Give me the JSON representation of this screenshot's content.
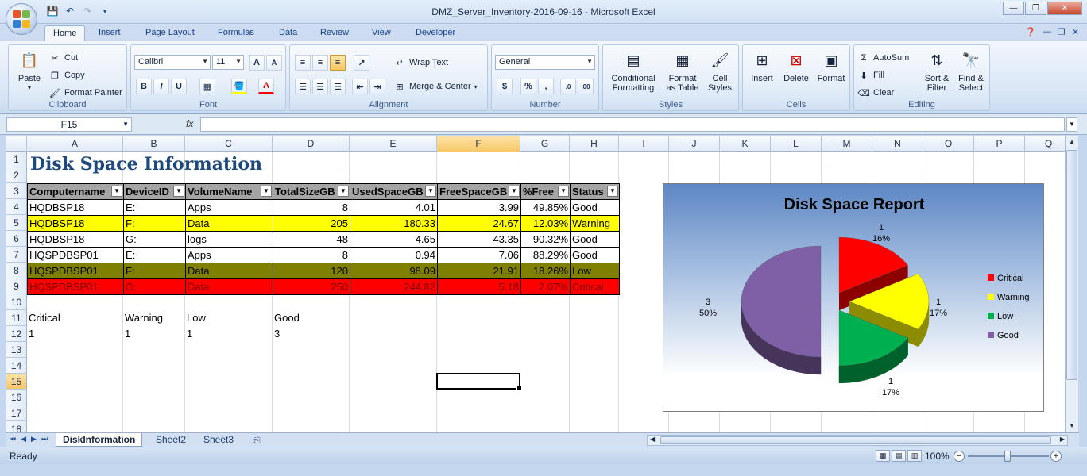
{
  "window": {
    "title": "DMZ_Server_Inventory-2016-09-16 - Microsoft Excel",
    "min_label": "—",
    "max_label": "❐",
    "close_label": "✕"
  },
  "tabs": [
    "Home",
    "Insert",
    "Page Layout",
    "Formulas",
    "Data",
    "Review",
    "View",
    "Developer"
  ],
  "ribbon": {
    "clipboard": {
      "label": "Clipboard",
      "paste": "Paste",
      "cut": "Cut",
      "copy": "Copy",
      "format_painter": "Format Painter"
    },
    "font": {
      "label": "Font",
      "name": "Calibri",
      "size": "11"
    },
    "alignment": {
      "label": "Alignment",
      "wrap_text": "Wrap Text",
      "merge_center": "Merge & Center"
    },
    "number": {
      "label": "Number",
      "format": "General",
      "currency": "$",
      "percent": "%",
      "comma": ","
    },
    "styles": {
      "label": "Styles",
      "conditional": "Conditional\nFormatting",
      "format_table": "Format\nas Table",
      "cell_styles": "Cell\nStyles"
    },
    "cells": {
      "label": "Cells",
      "insert": "Insert",
      "delete": "Delete",
      "format": "Format"
    },
    "editing": {
      "label": "Editing",
      "autosum": "AutoSum",
      "fill": "Fill",
      "clear": "Clear",
      "sort_filter": "Sort &\nFilter",
      "find_select": "Find &\nSelect"
    }
  },
  "formula_bar": {
    "name_box": "F15",
    "fx": "fx",
    "value": ""
  },
  "columns": [
    "A",
    "B",
    "C",
    "D",
    "E",
    "F",
    "G",
    "H",
    "I",
    "J",
    "K",
    "L",
    "M",
    "N",
    "O",
    "P",
    "Q"
  ],
  "rows": [
    "1",
    "2",
    "3",
    "4",
    "5",
    "6",
    "7",
    "8",
    "9",
    "10",
    "11",
    "12",
    "13",
    "14",
    "15",
    "16",
    "17",
    "18"
  ],
  "sheet": {
    "heading": "Disk Space Information",
    "table_headers": [
      "Computername",
      "DeviceID",
      "VolumeName",
      "TotalSizeGB",
      "UsedSpaceGB",
      "FreeSpaceGB",
      "%Free",
      "Status"
    ],
    "table_rows": [
      [
        "HQDBSP18",
        "E:",
        "Apps",
        "8",
        "4.01",
        "3.99",
        "49.85%",
        "Good"
      ],
      [
        "HQDBSP18",
        "F:",
        "Data",
        "205",
        "180.33",
        "24.67",
        "12.03%",
        "Warning"
      ],
      [
        "HQDBSP18",
        "G:",
        "logs",
        "48",
        "4.65",
        "43.35",
        "90.32%",
        "Good"
      ],
      [
        "HQSPDBSP01",
        "E:",
        "Apps",
        "8",
        "0.94",
        "7.06",
        "88.29%",
        "Good"
      ],
      [
        "HQSPDBSP01",
        "F:",
        "Data",
        "120",
        "98.09",
        "21.91",
        "18.26%",
        "Low"
      ],
      [
        "HQSPDBSP01",
        "G:",
        "Data",
        "250",
        "244.82",
        "5.18",
        "2.07%",
        "Critical"
      ]
    ],
    "summary_labels": [
      "Critical",
      "Warning",
      "Low",
      "Good"
    ],
    "summary_values": [
      "1",
      "1",
      "1",
      "3"
    ]
  },
  "chart_data": {
    "type": "pie",
    "title": "Disk Space Report",
    "categories": [
      "Critical",
      "Warning",
      "Low",
      "Good"
    ],
    "values": [
      1,
      1,
      1,
      3
    ],
    "labels": [
      "1\n16%",
      "1\n17%",
      "1\n17%",
      "3\n50%"
    ],
    "colors": [
      "#ff0000",
      "#ffff00",
      "#00b050",
      "#7f5fa6"
    ],
    "legend": "right",
    "exploded": true,
    "three_d": true
  },
  "sheet_tabs": [
    "DiskInformation",
    "Sheet2",
    "Sheet3"
  ],
  "status": {
    "ready": "Ready",
    "zoom": "100%"
  }
}
